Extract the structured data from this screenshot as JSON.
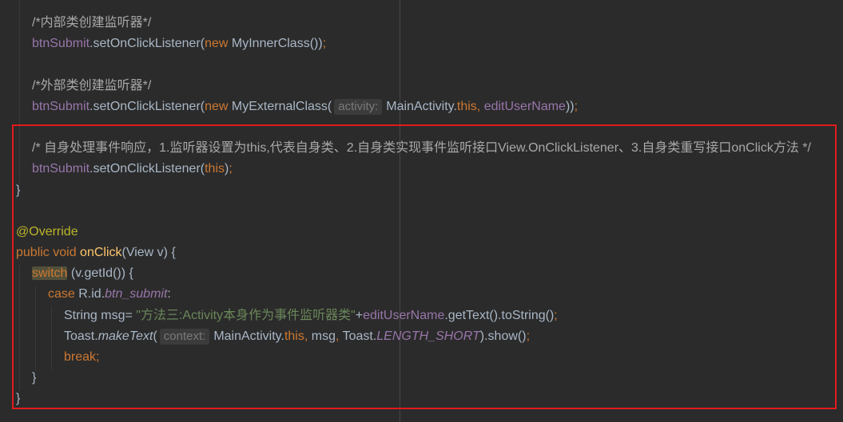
{
  "theme": {
    "background": "#2b2b2b",
    "text": "#a9b7c6",
    "highlight_border": "#e31b1b",
    "margin_guide": "#454545"
  },
  "editor": {
    "lines": [
      {
        "indent": 1,
        "tokens": [
          {
            "text": "/*内部类创建监听器*/",
            "color": "#a8a8a8"
          }
        ]
      },
      {
        "indent": 1,
        "tokens": [
          {
            "text": "btnSubmit",
            "color": "#9876aa"
          },
          {
            "text": ".setOnClickListener("
          },
          {
            "text": "new",
            "color": "#cc7832"
          },
          {
            "text": " MyInnerClass())"
          },
          {
            "text": ";",
            "color": "#cc7832"
          }
        ]
      },
      {
        "tokens": []
      },
      {
        "indent": 1,
        "tokens": [
          {
            "text": "/*外部类创建监听器*/",
            "color": "#a8a8a8"
          }
        ]
      },
      {
        "indent": 1,
        "tokens": [
          {
            "text": "btnSubmit",
            "color": "#9876aa"
          },
          {
            "text": ".setOnClickListener("
          },
          {
            "text": "new",
            "color": "#cc7832"
          },
          {
            "text": " MyExternalClass("
          },
          {
            "text": "activity:",
            "hint": true
          },
          {
            "text": "MainActivity."
          },
          {
            "text": "this",
            "color": "#cc7832"
          },
          {
            "text": ", ",
            "color": "#cc7832"
          },
          {
            "text": "editUserName",
            "color": "#9876aa"
          },
          {
            "text": "))"
          },
          {
            "text": ";",
            "color": "#cc7832"
          }
        ]
      },
      {
        "tokens": []
      },
      {
        "indent": 1,
        "tokens": [
          {
            "text": "/* 自身处理事件响应，1.监听器设置为this,代表自身类、2.自身类实现事件监听接口View.OnClickListener、3.自身类重写接口onClick方法 */",
            "color": "#a8a8a8"
          }
        ]
      },
      {
        "indent": 1,
        "tokens": [
          {
            "text": "btnSubmit",
            "color": "#9876aa"
          },
          {
            "text": ".setOnClickListener("
          },
          {
            "text": "this",
            "color": "#cc7832"
          },
          {
            "text": ")"
          },
          {
            "text": ";",
            "color": "#cc7832"
          }
        ]
      },
      {
        "indent": 0,
        "tokens": [
          {
            "text": "}"
          }
        ]
      },
      {
        "tokens": []
      },
      {
        "indent": 0,
        "tokens": [
          {
            "text": "@Override",
            "color": "#bbb529"
          }
        ]
      },
      {
        "indent": 0,
        "tokens": [
          {
            "text": "public void ",
            "color": "#cc7832"
          },
          {
            "text": "onClick",
            "color": "#ffc66d"
          },
          {
            "text": "(View v) {"
          }
        ]
      },
      {
        "indent": 1,
        "tokens": [
          {
            "text": "switch",
            "color": "#cc7832",
            "bg": "#52503a"
          },
          {
            "text": " (v.getId()) {"
          }
        ]
      },
      {
        "indent": 2,
        "tokens": [
          {
            "text": "case",
            "color": "#cc7832"
          },
          {
            "text": " R.id."
          },
          {
            "text": "btn_submit",
            "color": "#9876aa",
            "italic": true
          },
          {
            "text": ":"
          }
        ]
      },
      {
        "indent": 3,
        "tokens": [
          {
            "text": "String msg= "
          },
          {
            "text": "\"方法三:Activity本身作为事件监听器类\"",
            "color": "#6a8759"
          },
          {
            "text": "+"
          },
          {
            "text": "editUserName",
            "color": "#9876aa"
          },
          {
            "text": ".getText().toString()"
          },
          {
            "text": ";",
            "color": "#cc7832"
          }
        ]
      },
      {
        "indent": 3,
        "tokens": [
          {
            "text": "Toast."
          },
          {
            "text": "makeText",
            "italic": true
          },
          {
            "text": "("
          },
          {
            "text": "context:",
            "hint": true
          },
          {
            "text": "MainActivity."
          },
          {
            "text": "this",
            "color": "#cc7832"
          },
          {
            "text": ", ",
            "color": "#cc7832"
          },
          {
            "text": "msg"
          },
          {
            "text": ", ",
            "color": "#cc7832"
          },
          {
            "text": "Toast."
          },
          {
            "text": "LENGTH_SHORT",
            "color": "#9876aa",
            "italic": true
          },
          {
            "text": ").show()"
          },
          {
            "text": ";",
            "color": "#cc7832"
          }
        ]
      },
      {
        "indent": 3,
        "tokens": [
          {
            "text": "break;",
            "color": "#cc7832"
          }
        ]
      },
      {
        "indent": 1,
        "tokens": [
          {
            "text": "}"
          }
        ]
      },
      {
        "indent": 0,
        "tokens": [
          {
            "text": "}"
          }
        ]
      }
    ]
  }
}
